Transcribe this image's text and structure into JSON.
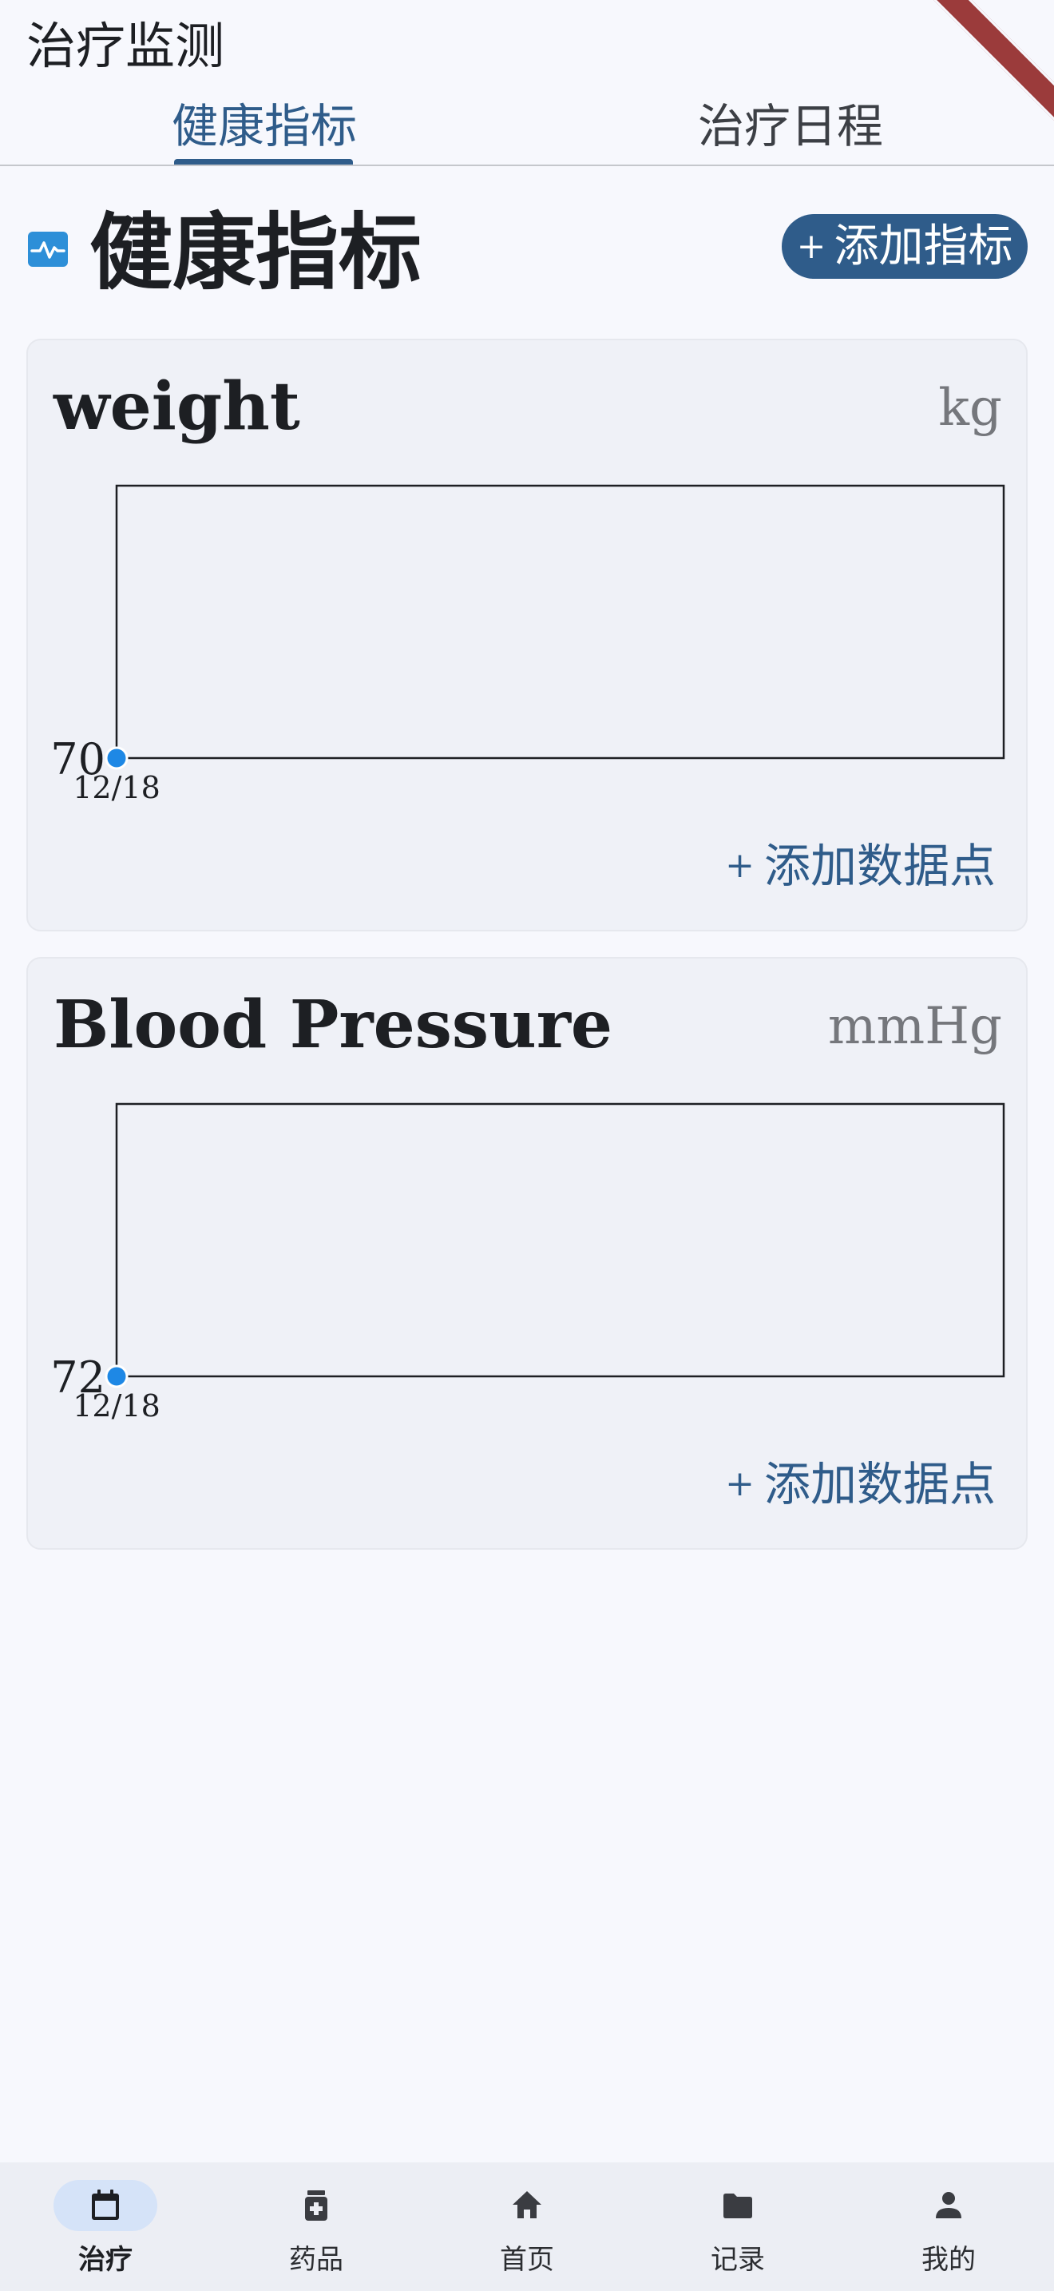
{
  "app": {
    "title": "治疗监测"
  },
  "tabs": [
    {
      "label": "健康指标",
      "active": true
    },
    {
      "label": "治疗日程",
      "active": false
    }
  ],
  "section": {
    "title": "健康指标",
    "icon": "monitor-heart-icon",
    "add_button_label": "添加指标"
  },
  "metrics": [
    {
      "name": "weight",
      "unit": "kg",
      "add_point_label": "添加数据点",
      "chart_data": {
        "type": "line",
        "x": [
          "12/18"
        ],
        "series": [
          {
            "values": [
              70
            ]
          }
        ]
      }
    },
    {
      "name": "Blood Pressure",
      "unit": "mmHg",
      "add_point_label": "添加数据点",
      "chart_data": {
        "type": "line",
        "x": [
          "12/18"
        ],
        "series": [
          {
            "values": [
              72
            ]
          }
        ]
      }
    }
  ],
  "nav": {
    "items": [
      {
        "label": "治疗",
        "icon": "calendar-icon",
        "active": true
      },
      {
        "label": "药品",
        "icon": "medication-icon",
        "active": false
      },
      {
        "label": "首页",
        "icon": "home-icon",
        "active": false
      },
      {
        "label": "记录",
        "icon": "folder-icon",
        "active": false
      },
      {
        "label": "我的",
        "icon": "person-icon",
        "active": false
      }
    ]
  },
  "colors": {
    "accent": "#2f5c8a",
    "point": "#1e88e5",
    "background": "#f7f8fd",
    "card": "#eff1f7",
    "nav_active_pill": "#d5e3f8"
  }
}
